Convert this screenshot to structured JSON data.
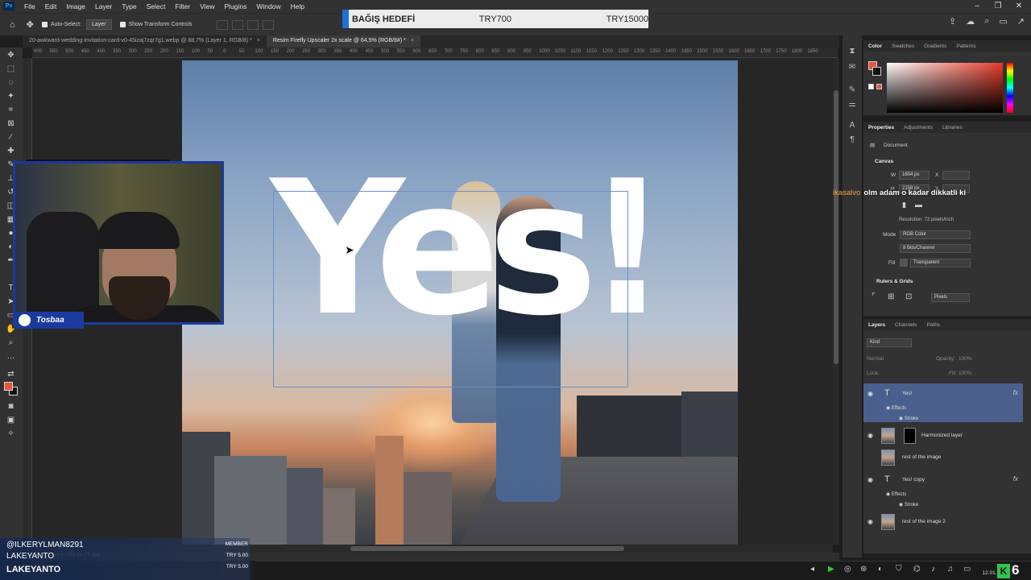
{
  "menu": {
    "items": [
      "File",
      "Edit",
      "Image",
      "Layer",
      "Type",
      "Select",
      "Filter",
      "View",
      "Plugins",
      "Window",
      "Help"
    ]
  },
  "options": {
    "auto_select": "Auto-Select:",
    "layer_select": "Layer",
    "transform": "Show Transform Controls"
  },
  "banner": {
    "title": "BAĞIŞ HEDEFİ",
    "current": "TRY700",
    "goal": "TRY15000"
  },
  "tabs": [
    {
      "label": "20-awkward-wedding-invitation-card-v0-45izaj7zqr7g1.webp @ 88,7% (Layer 1, RGB/8) *",
      "close": "×"
    },
    {
      "label": "Resim Firefly Upscaler 2x scale @ 64,5% (RGB/8#) *",
      "close": "×"
    }
  ],
  "ruler_ticks": [
    "600",
    "550",
    "500",
    "450",
    "400",
    "350",
    "300",
    "250",
    "200",
    "150",
    "100",
    "50",
    "0",
    "50",
    "100",
    "150",
    "200",
    "250",
    "300",
    "350",
    "400",
    "450",
    "500",
    "550",
    "600",
    "650",
    "700",
    "750",
    "800",
    "850",
    "900",
    "950",
    "1000",
    "1050",
    "1100",
    "1150",
    "1200",
    "1250",
    "1300",
    "1350",
    "1400",
    "1450",
    "1500",
    "1550",
    "1600",
    "1650",
    "1700",
    "1750",
    "1800",
    "1850"
  ],
  "canvas": {
    "text": "Yes!"
  },
  "panels": {
    "color_tabs": [
      "Color",
      "Swatches",
      "Gradients",
      "Patterns"
    ],
    "props_tabs": [
      "Properties",
      "Adjustments",
      "Libraries"
    ],
    "document": "Document",
    "canvas_section": "Canvas",
    "width_label": "W",
    "width_value": "1604 px",
    "height_label": "H",
    "height_value": "2158 px",
    "x_label": "X",
    "y_label": "Y",
    "resolution": "Resolution: 72 pixels/inch",
    "mode_label": "Mode",
    "mode_value": "RGB Color",
    "bits_value": "8 Bits/Channel",
    "fill_label": "Fill",
    "fill_value": "Transparent",
    "rulers_section": "Rulers & Grids",
    "units_value": "Pixels",
    "layers_tabs": [
      "Layers",
      "Channels",
      "Paths"
    ],
    "kind": "Kind",
    "blend": "Normal",
    "opacity": "Opacity:",
    "opacity_value": "100%",
    "lock": "Lock:",
    "fill_pct_label": "Fill:",
    "fill_pct_value": "100%"
  },
  "layers": [
    {
      "name": "Yes!",
      "type": "text",
      "fx": "fx",
      "effects": "Effects",
      "stroke": "Stroke"
    },
    {
      "name": "Harmonized layer",
      "type": "image"
    },
    {
      "name": "rest of the image",
      "type": "image"
    },
    {
      "name": "Yes! copy",
      "type": "text",
      "fx": "fx",
      "effects": "Effects",
      "stroke": "Stroke"
    },
    {
      "name": "rest of the image 2",
      "type": "image"
    }
  ],
  "statusbar": "64,5% 1604 px x 2158 px (72 ppi)",
  "stream": {
    "cam_name": "Tosbaa",
    "chat_user": "ikasalvo",
    "chat_msg": "olm adam o kadar dikkatli ki",
    "sub_handle": "@ILKERYLMAN8291",
    "sub_name1": "LAKEYANTO",
    "sub_name2": "LAKEYANTO",
    "member": "MEMBER",
    "amount1": "TRY 5.00",
    "amount2": "TRY 5.00"
  },
  "taskbar": {
    "date": "12.01.2026",
    "badge_k": "K",
    "badge_num": "6"
  },
  "colors": {
    "accent_blue": "#1b3a9e",
    "foreground": "#e8543a",
    "selected_layer": "#4a5f8c",
    "chat_user": "#f0a040"
  }
}
